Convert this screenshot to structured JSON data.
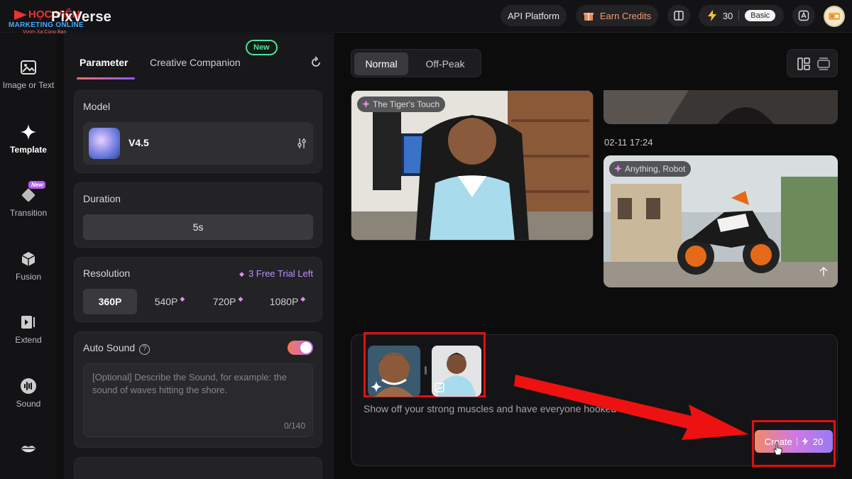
{
  "app": {
    "brand": "PixVerse",
    "brand_overlay": "HỌC VIỆN",
    "watermark_line1": "MARKETING ONLINE",
    "watermark_line2": "Vươn Xa Cùng Bạn"
  },
  "topbar": {
    "api_platform": "API Platform",
    "earn_credits": "Earn Credits",
    "credits": "30",
    "plan": "Basic"
  },
  "leftnav": {
    "items": [
      {
        "label": "Image or Text",
        "icon": "image-icon"
      },
      {
        "label": "Template",
        "icon": "sparkle-icon"
      },
      {
        "label": "Transition",
        "icon": "transition-icon",
        "tag": "New"
      },
      {
        "label": "Fusion",
        "icon": "cube-icon"
      },
      {
        "label": "Extend",
        "icon": "extend-icon"
      },
      {
        "label": "Sound",
        "icon": "sound-icon"
      },
      {
        "label": "",
        "icon": "lips-icon"
      }
    ]
  },
  "panel": {
    "tab_parameter": "Parameter",
    "tab_companion": "Creative Companion",
    "new_badge": "New",
    "model": {
      "title": "Model",
      "name": "V4.5"
    },
    "duration": {
      "title": "Duration",
      "value": "5s"
    },
    "resolution": {
      "title": "Resolution",
      "trial": "3 Free Trial Left",
      "options": [
        "360P",
        "540P",
        "720P",
        "1080P"
      ],
      "selected": "360P"
    },
    "auto_sound": {
      "title": "Auto Sound",
      "enabled": true,
      "placeholder": "[Optional] Describe the Sound, for example: the sound of waves hitting the shore.",
      "counter": "0/140"
    }
  },
  "main": {
    "mode_normal": "Normal",
    "mode_offpeak": "Off-Peak",
    "video1_label": "The Tiger's Touch",
    "timestamp": "02-11 17:24",
    "video2_label": "Anything, Robot",
    "prompt_text": "Show off your strong muscles and have everyone hooked",
    "create_label": "Create",
    "create_cost": "20"
  },
  "colors": {
    "accent_gradient_start": "#f08a6a",
    "accent_gradient_end": "#9a7af5",
    "new_badge": "#4ee39a",
    "annotation_red": "#e01010"
  }
}
